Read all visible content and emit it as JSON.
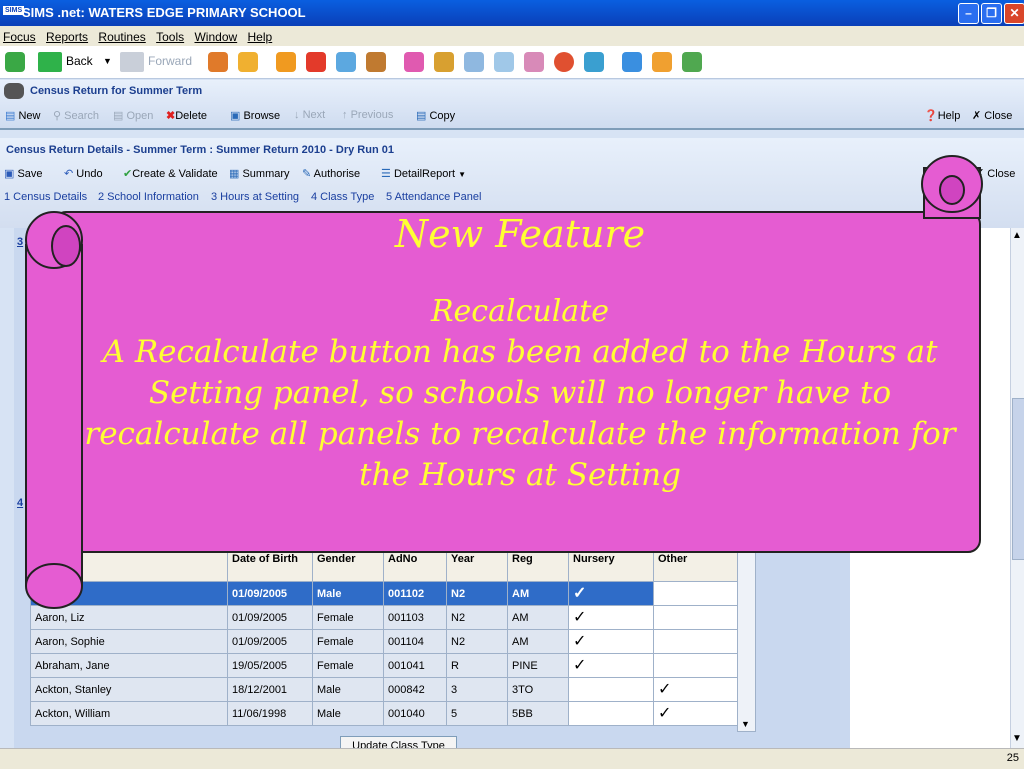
{
  "window": {
    "app_icon": "SIMS",
    "title": "SIMS .net: WATERS EDGE PRIMARY SCHOOL"
  },
  "menu": [
    "Focus",
    "Reports",
    "Routines",
    "Tools",
    "Window",
    "Help"
  ],
  "nav": {
    "back": "Back",
    "forward": "Forward"
  },
  "census_panel": {
    "title": "Census Return for Summer Term",
    "buttons": {
      "new": "New",
      "search": "Search",
      "open": "Open",
      "delete": "Delete",
      "browse": "Browse",
      "next": "Next",
      "previous": "Previous",
      "copy": "Copy",
      "help": "Help",
      "close": "Close"
    }
  },
  "details_panel": {
    "title": "Census Return Details - Summer Term : Summer Return 2010 - Dry Run 01",
    "buttons": {
      "save": "Save",
      "undo": "Undo",
      "create_validate": "Create & Validate",
      "summary": "Summary",
      "authorise": "Authorise",
      "detail_report": "DetailReport",
      "close": "Close"
    },
    "links": [
      "1 Census Details",
      "2 School Information",
      "3 Hours at Setting",
      "4 Class Type",
      "5 Attendance Panel"
    ],
    "side_numbers": [
      "3",
      "4"
    ]
  },
  "grid": {
    "headers": [
      "Date of Birth",
      "Gender",
      "AdNo",
      "Year",
      "Reg",
      "Nursery",
      "Other"
    ],
    "rows": [
      {
        "name": "hris",
        "dob": "01/09/2005",
        "gender": "Male",
        "adno": "001102",
        "year": "N2",
        "reg": "AM",
        "nursery": "✓",
        "other": ""
      },
      {
        "name": "Aaron, Liz",
        "dob": "01/09/2005",
        "gender": "Female",
        "adno": "001103",
        "year": "N2",
        "reg": "AM",
        "nursery": "✓",
        "other": ""
      },
      {
        "name": "Aaron, Sophie",
        "dob": "01/09/2005",
        "gender": "Female",
        "adno": "001104",
        "year": "N2",
        "reg": "AM",
        "nursery": "✓",
        "other": ""
      },
      {
        "name": "Abraham, Jane",
        "dob": "19/05/2005",
        "gender": "Female",
        "adno": "001041",
        "year": "R",
        "reg": "PINE",
        "nursery": "✓",
        "other": ""
      },
      {
        "name": "Ackton, Stanley",
        "dob": "18/12/2001",
        "gender": "Male",
        "adno": "000842",
        "year": "3",
        "reg": "3TO",
        "nursery": "",
        "other": "✓"
      },
      {
        "name": "Ackton, William",
        "dob": "11/06/1998",
        "gender": "Male",
        "adno": "001040",
        "year": "5",
        "reg": "5BB",
        "nursery": "",
        "other": "✓"
      }
    ],
    "update_button": "Update Class Type"
  },
  "banner": {
    "heading": "New Feature",
    "subheading": "Recalculate",
    "body": "A Recalculate button has been added to the Hours at Setting panel, so schools will no longer have to recalculate all panels to recalculate the information for the Hours at Setting"
  },
  "status": {
    "page_number": "25"
  },
  "colors": {
    "banner_fill": "#e55cd2",
    "banner_text": "#ffff33",
    "title_bar": "#0a4fd0",
    "selected_row": "#2f6cc8"
  }
}
